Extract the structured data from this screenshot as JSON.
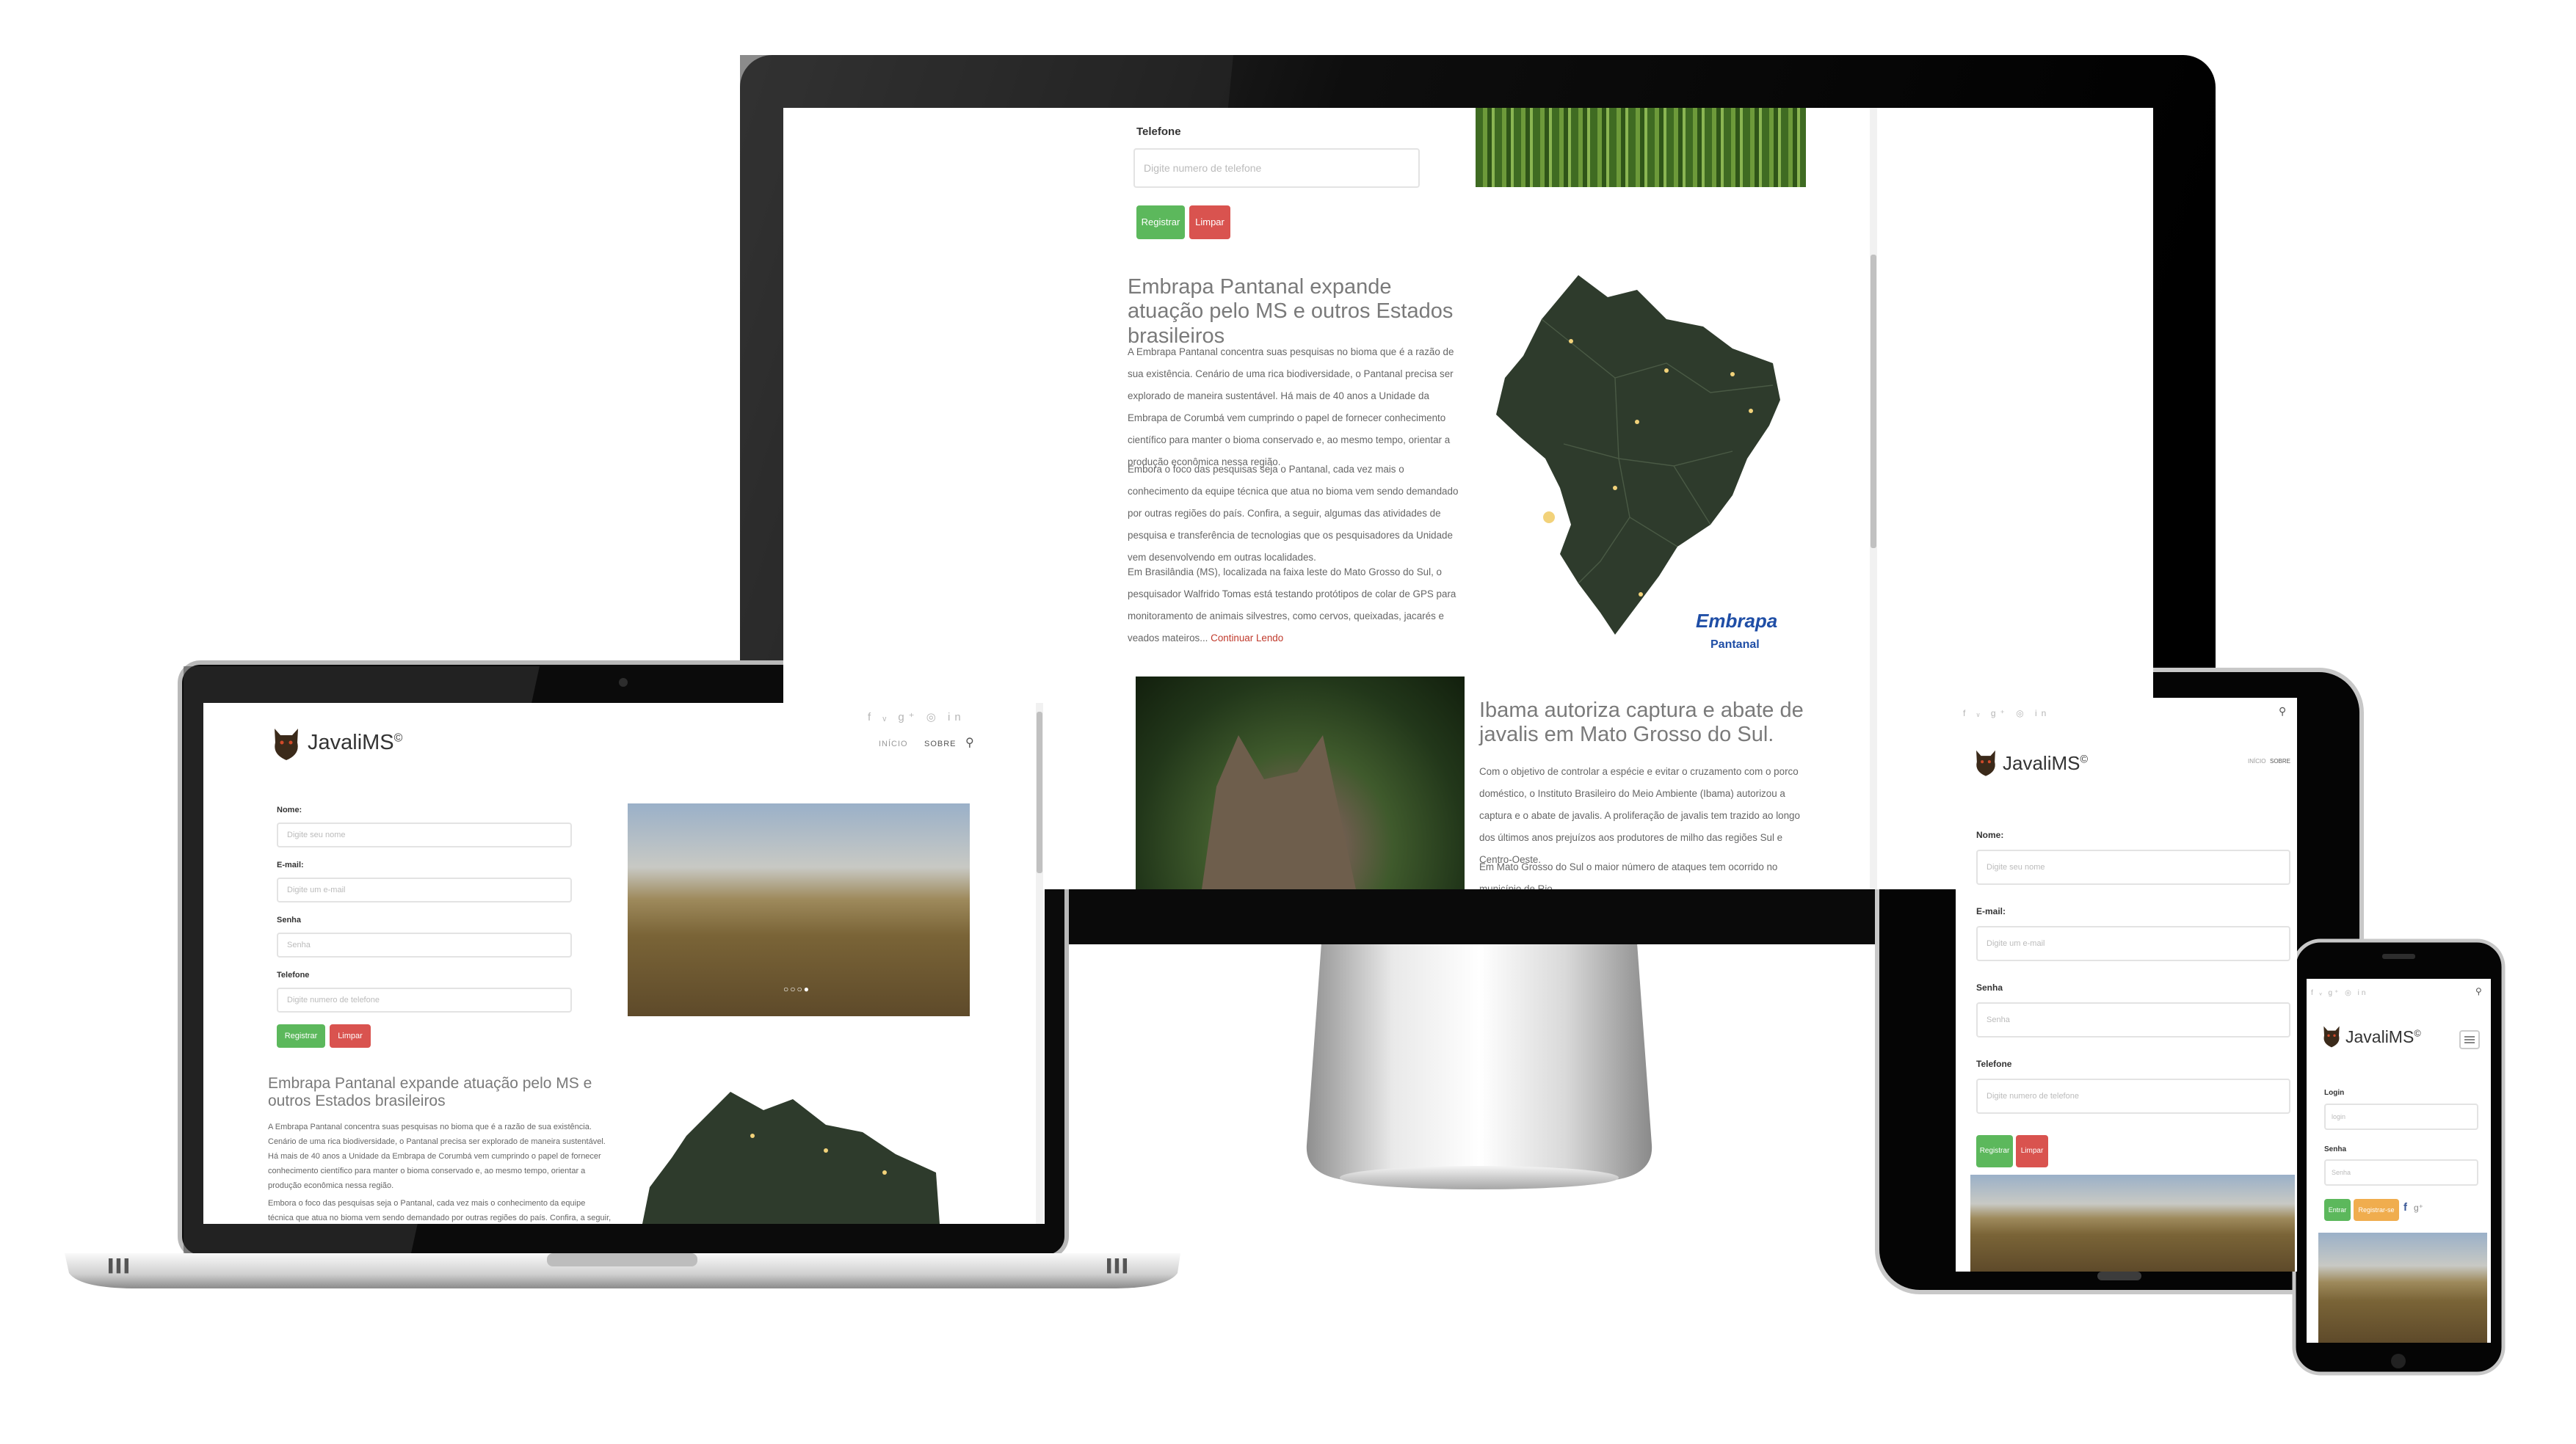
{
  "brand": {
    "name": "JavaliMS",
    "mark": "©"
  },
  "social_icons": [
    "facebook-icon",
    "twitter-icon",
    "google-plus-icon",
    "github-icon",
    "linkedin-icon"
  ],
  "social_glyphs": "f  ᵥ  g⁺  ◎  in",
  "nav": {
    "inicio": "INÍCIO",
    "sobre": "SOBRE",
    "search_glyph": "⚲"
  },
  "form": {
    "nome_label": "Nome:",
    "nome_placeholder": "Digite seu nome",
    "email_label": "E-mail:",
    "email_placeholder": "Digite um e-mail",
    "senha_label": "Senha",
    "senha_placeholder": "Senha",
    "telefone_label": "Telefone",
    "telefone_placeholder": "Digite numero de telefone",
    "registrar": "Registrar",
    "limpar": "Limpar"
  },
  "login": {
    "login_label": "Login",
    "login_placeholder": "login",
    "senha_label": "Senha",
    "senha_placeholder": "Senha",
    "entrar": "Entrar",
    "registrar_se": "Registrar-se",
    "fb": "f",
    "gplus": "g⁺"
  },
  "article1": {
    "title": "Embrapa Pantanal expande atuação pelo MS e outros Estados brasileiros",
    "p1": "A Embrapa Pantanal concentra suas pesquisas no bioma que é a razão de sua existência. Cenário de uma rica biodiversidade, o Pantanal precisa ser explorado de maneira sustentável. Há mais de 40 anos a Unidade da Embrapa de Corumbá vem cumprindo o papel de fornecer conhecimento científico para manter o bioma conservado e, ao mesmo tempo, orientar a produção econômica nessa região.",
    "p2": "Embora o foco das pesquisas seja o Pantanal, cada vez mais o conhecimento da equipe técnica que atua no bioma vem sendo demandado por outras regiões do país. Confira, a seguir, algumas das atividades de pesquisa e transferência de tecnologias que os pesquisadores da Unidade vem desenvolvendo em outras localidades.",
    "p3": "Em Brasilândia (MS), localizada na faixa leste do Mato Grosso do Sul, o pesquisador Walfrido Tomas está testando protótipos de colar de GPS para monitoramento de animais silvestres, como cervos, queixadas, jacarés e veados mateiros...",
    "more": "Continuar Lendo",
    "map_logo": "Embrapa",
    "map_logo_sub": "Pantanal"
  },
  "article2": {
    "title": "Ibama autoriza captura e abate de javalis em Mato Grosso do Sul.",
    "p1": "Com o objetivo de controlar a espécie e evitar o cruzamento com o porco doméstico, o Instituto Brasileiro do Meio Ambiente (Ibama) autorizou a captura e o abate de javalis. A proliferação de javalis tem trazido ao longo dos últimos anos prejuízos aos produtores de milho das regiões Sul e Centro-Oeste.",
    "p2": "Em Mato Grosso do Sul o maior número de ataques tem ocorrido no município de Rio"
  },
  "colors": {
    "green": "#5cb85c",
    "red": "#d9534f",
    "orange": "#f0ad4e",
    "map": "#2e3b2c"
  }
}
